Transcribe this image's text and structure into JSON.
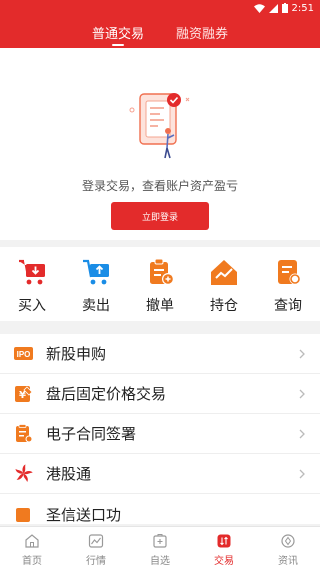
{
  "status_bar": {
    "time": "2:51"
  },
  "header": {
    "tabs": [
      {
        "label": "普通交易",
        "active": true
      },
      {
        "label": "融资融券",
        "active": false
      }
    ]
  },
  "login": {
    "tip": "登录交易，查看账户资产盈亏",
    "button": "立即登录"
  },
  "quick_actions": [
    {
      "label": "买入",
      "icon": "cart-download-icon"
    },
    {
      "label": "卖出",
      "icon": "cart-upload-icon"
    },
    {
      "label": "撤单",
      "icon": "clipboard-undo-icon"
    },
    {
      "label": "持仓",
      "icon": "house-chart-icon"
    },
    {
      "label": "查询",
      "icon": "document-search-icon"
    }
  ],
  "menu": [
    {
      "label": "新股申购",
      "icon": "ipo-icon",
      "icon_text": "IPO"
    },
    {
      "label": "盘后固定价格交易",
      "icon": "fixed-price-icon"
    },
    {
      "label": "电子合同签署",
      "icon": "contract-icon"
    },
    {
      "label": "港股通",
      "icon": "bauhinia-icon"
    },
    {
      "label": "圣信送口功",
      "icon": "partial-item-icon"
    }
  ],
  "tab_bar": [
    {
      "label": "首页",
      "icon": "home-icon",
      "active": false
    },
    {
      "label": "行情",
      "icon": "chart-icon",
      "active": false
    },
    {
      "label": "自选",
      "icon": "watchlist-icon",
      "active": false
    },
    {
      "label": "交易",
      "icon": "trade-icon",
      "active": true
    },
    {
      "label": "资讯",
      "icon": "news-icon",
      "active": false
    }
  ],
  "colors": {
    "brand_red": "#e32b2b",
    "accent_orange": "#f07a1f"
  }
}
